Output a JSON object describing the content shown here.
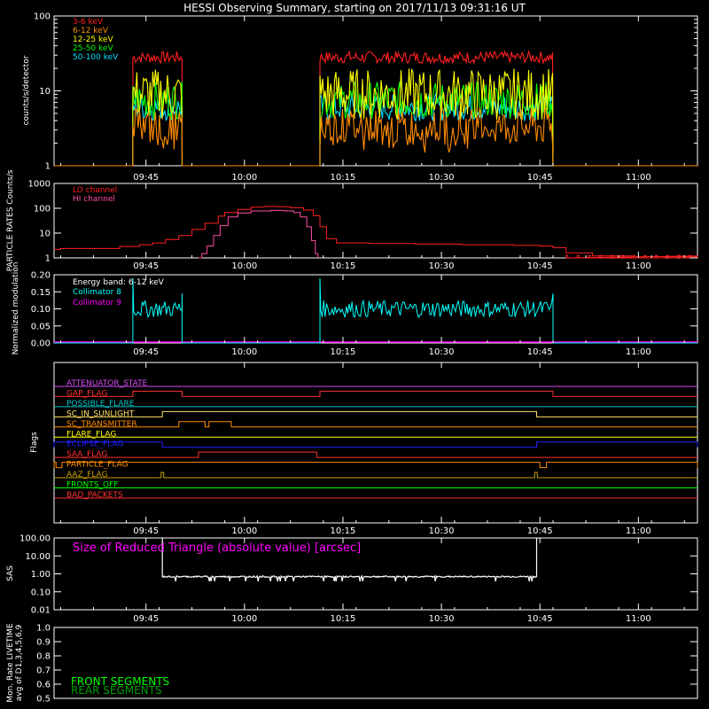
{
  "title": "HESSI Observing Summary, starting on 2017/11/13 09:31:16 UT",
  "colors": {
    "background": "#000000",
    "axes": "#ffffff",
    "e_3_6": "#ff2020",
    "e_6_12": "#ff8c00",
    "e_12_25": "#ffff00",
    "e_25_50": "#00ff00",
    "e_50_100": "#00e0ff",
    "lo": "#ff2020",
    "hi": "#ff4da6",
    "coll8": "#00ffff",
    "coll9": "#ff00ff",
    "sas": "#ffffff"
  },
  "time_axis": {
    "ticks": [
      "09:45",
      "10:00",
      "10:15",
      "10:30",
      "10:45",
      "11:00"
    ],
    "tick_minutes_after_0931": [
      14,
      29,
      44,
      59,
      74,
      89
    ],
    "minor_step_minutes": 5,
    "range_minutes": [
      0,
      98
    ]
  },
  "chart_data": [
    {
      "type": "line",
      "panel": "count-rates",
      "ylabel": "counts/s/detector",
      "yscale": "log",
      "ylim": [
        1,
        100
      ],
      "yticks": [
        "1",
        "10",
        "100"
      ],
      "legend": [
        "3-6 keV",
        "6-12 keV",
        "12-25 keV",
        "25-50 keV",
        "50-100 keV"
      ],
      "legend_placement": "top-left",
      "segments_minutes": [
        [
          12,
          19.5
        ],
        [
          40.5,
          76
        ]
      ],
      "series": [
        {
          "name": "3-6 keV",
          "level": 28
        },
        {
          "name": "6-12 keV",
          "level": 3.3
        },
        {
          "name": "12-25 keV",
          "level": 9
        },
        {
          "name": "25-50 keV",
          "level": 7.5
        },
        {
          "name": "50-100 keV",
          "level": 6
        }
      ]
    },
    {
      "type": "line",
      "panel": "particle-rates",
      "ylabel": "PARTICLE RATES Counts/s",
      "yscale": "log",
      "ylim": [
        1,
        1000
      ],
      "yticks": [
        "1",
        "10",
        "100",
        "1000"
      ],
      "legend": [
        "LO channel",
        "HI channel"
      ],
      "legend_placement": "top-left",
      "series": [
        {
          "name": "LO channel",
          "points": [
            [
              0,
              2.2
            ],
            [
              1,
              2.4
            ],
            [
              8,
              2.4
            ],
            [
              10,
              2.9
            ],
            [
              13,
              3.4
            ],
            [
              15,
              4
            ],
            [
              17,
              5.5
            ],
            [
              19,
              8
            ],
            [
              21,
              14
            ],
            [
              23,
              25
            ],
            [
              25,
              48
            ],
            [
              26,
              68
            ],
            [
              28,
              90
            ],
            [
              30,
              110
            ],
            [
              32,
              118
            ],
            [
              34,
              116
            ],
            [
              36,
              105
            ],
            [
              38,
              85
            ],
            [
              39.5,
              50
            ],
            [
              40.5,
              18
            ],
            [
              41.5,
              6
            ],
            [
              43,
              4
            ],
            [
              48,
              3.8
            ],
            [
              55,
              3.6
            ],
            [
              62,
              3.4
            ],
            [
              70,
              3.2
            ],
            [
              74,
              3
            ],
            [
              76,
              2.6
            ],
            [
              78,
              1.6
            ],
            [
              82,
              1.2
            ],
            [
              88,
              1
            ],
            [
              93,
              1.1
            ],
            [
              98,
              1.2
            ]
          ]
        },
        {
          "name": "HI channel",
          "points": [
            [
              22,
              1
            ],
            [
              22.5,
              1.5
            ],
            [
              23.3,
              3
            ],
            [
              24.3,
              8
            ],
            [
              25.3,
              20
            ],
            [
              26.5,
              45
            ],
            [
              28,
              65
            ],
            [
              30,
              78
            ],
            [
              33,
              82
            ],
            [
              35,
              78
            ],
            [
              36.5,
              68
            ],
            [
              37.5,
              45
            ],
            [
              38.5,
              18
            ],
            [
              39.2,
              5
            ],
            [
              39.8,
              1.5
            ],
            [
              40.2,
              1
            ]
          ]
        }
      ]
    },
    {
      "type": "line",
      "panel": "modulation",
      "ylabel": "Normalized modulation",
      "ylim": [
        0,
        0.2
      ],
      "yticks": [
        "0.00",
        "0.05",
        "0.10",
        "0.15",
        "0.20"
      ],
      "legend": [
        "Energy band: 6-12 keV",
        "Collimator 8",
        "Collimator 9"
      ],
      "legend_placement": "top-left",
      "segments_minutes": [
        [
          12,
          19.5
        ],
        [
          40.5,
          76
        ]
      ],
      "series": [
        {
          "name": "Collimator 8",
          "level": 0.1
        },
        {
          "name": "Collimator 9",
          "level": 0
        }
      ]
    },
    {
      "type": "line",
      "panel": "flags",
      "ylabel": "Flags",
      "flags": [
        {
          "name": "ATTENUATOR_STATE",
          "color": "#d04df0",
          "steps": []
        },
        {
          "name": "GAP_FLAG",
          "color": "#ff3030",
          "steps": [
            [
              12,
              19.5
            ],
            [
              40.5,
              76
            ]
          ]
        },
        {
          "name": "POSSIBLE_FLARE",
          "color": "#00c8c8",
          "steps": []
        },
        {
          "name": "SC_IN_SUNLIGHT",
          "color": "#ffe066",
          "steps": [
            [
              16.5,
              73.5
            ]
          ]
        },
        {
          "name": "SC_TRANSMITTER",
          "color": "#ff8c00",
          "steps": [
            [
              19,
              23
            ],
            [
              23.6,
              27
            ]
          ]
        },
        {
          "name": "FLARE_FLAG",
          "color": "#ffff00",
          "steps": []
        },
        {
          "name": "ECLIPSE_FLAG",
          "color": "#2020ff",
          "steps": [
            [
              0,
              16.5
            ],
            [
              73.5,
              98
            ]
          ]
        },
        {
          "name": "SAA_FLAG",
          "color": "#ff3030",
          "steps": [
            [
              22,
              40
            ]
          ]
        },
        {
          "name": "PARTICLE_FLAG",
          "color": "#ff8c00",
          "steps": [
            [
              0,
              0.3
            ],
            [
              1.2,
              74
            ],
            [
              75,
              98
            ]
          ]
        },
        {
          "name": "AAZ_FLAG",
          "color": "#c8a000",
          "steps": [
            [
              16.3,
              16.7
            ],
            [
              73.2,
              73.6
            ]
          ]
        },
        {
          "name": "FRONTS_OFF",
          "color": "#00ff00",
          "steps": []
        },
        {
          "name": "BAD_PACKETS",
          "color": "#ff3030",
          "steps": []
        }
      ]
    },
    {
      "type": "line",
      "panel": "sas",
      "ylabel": "SAS",
      "yscale": "log",
      "ylim": [
        0.01,
        100
      ],
      "yticks": [
        "0.01",
        "0.10",
        "1.00",
        "10.00",
        "100.00"
      ],
      "annotation": "Size of Reduced Triangle (absolute value) [arcsec]",
      "segment_minutes": [
        16.5,
        73.5
      ],
      "level": 0.7
    },
    {
      "type": "line",
      "panel": "livetime",
      "ylabel": "Mon. Rate LIVETIME avg of D1,3,4,5,6,9",
      "ylim": [
        0.5,
        1.0
      ],
      "yticks": [
        "0.5",
        "0.6",
        "0.7",
        "0.8",
        "0.9",
        "1.0"
      ],
      "legend": [
        "FRONT SEGMENTS",
        "REAR SEGMENTS"
      ],
      "legend_placement": "bottom-left"
    }
  ]
}
